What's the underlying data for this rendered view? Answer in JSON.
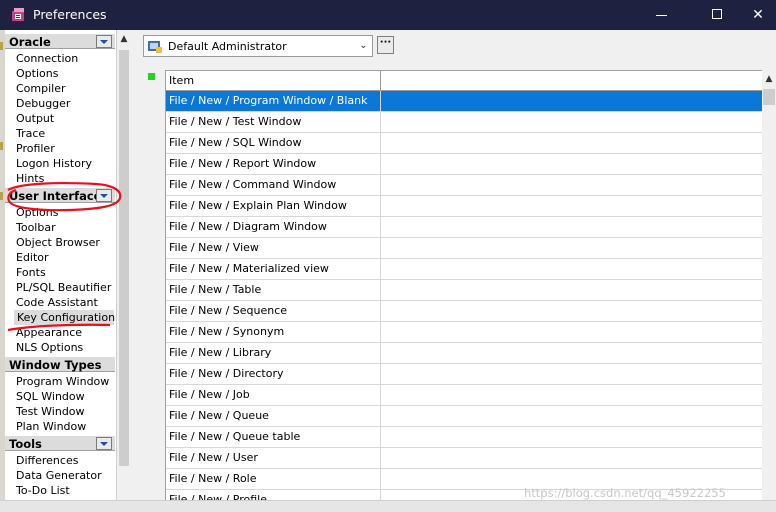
{
  "window": {
    "title": "Preferences",
    "icon": "preferences-app-icon"
  },
  "sidebar": {
    "groups": [
      {
        "label": "Oracle",
        "items": [
          "Connection",
          "Options",
          "Compiler",
          "Debugger",
          "Output",
          "Trace",
          "Profiler",
          "Logon History",
          "Hints"
        ]
      },
      {
        "label": "User Interface",
        "items": [
          "Options",
          "Toolbar",
          "Object Browser",
          "Editor",
          "Fonts",
          "PL/SQL Beautifier",
          "Code Assistant",
          "Key Configuration",
          "Appearance",
          "NLS Options"
        ]
      },
      {
        "label": "Window Types",
        "items": [
          "Program Window",
          "SQL Window",
          "Test Window",
          "Plan Window"
        ]
      },
      {
        "label": "Tools",
        "items": [
          "Differences",
          "Data Generator",
          "To-Do List"
        ]
      }
    ],
    "selected_item": "Key Configuration"
  },
  "profile": {
    "selected": "Default Administrator",
    "more_label": "···"
  },
  "grid": {
    "columns": [
      "Item",
      ""
    ],
    "rows": [
      "File / New / Program Window / Blank",
      "File / New / Test Window",
      "File / New / SQL Window",
      "File / New / Report Window",
      "File / New / Command Window",
      "File / New / Explain Plan Window",
      "File / New / Diagram Window",
      "File / New / View",
      "File / New / Materialized view",
      "File / New / Table",
      "File / New / Sequence",
      "File / New / Synonym",
      "File / New / Library",
      "File / New / Directory",
      "File / New / Job",
      "File / New / Queue",
      "File / New / Queue table",
      "File / New / User",
      "File / New / Role",
      "File / New / Profile"
    ],
    "selected_row": 0
  },
  "watermark": "https://blog.csdn.net/qq_45922255",
  "colors": {
    "titlebar": "#1f2140",
    "selection": "#0b78d7",
    "annotation": "#e8101a",
    "indicator": "#1fd61f"
  }
}
